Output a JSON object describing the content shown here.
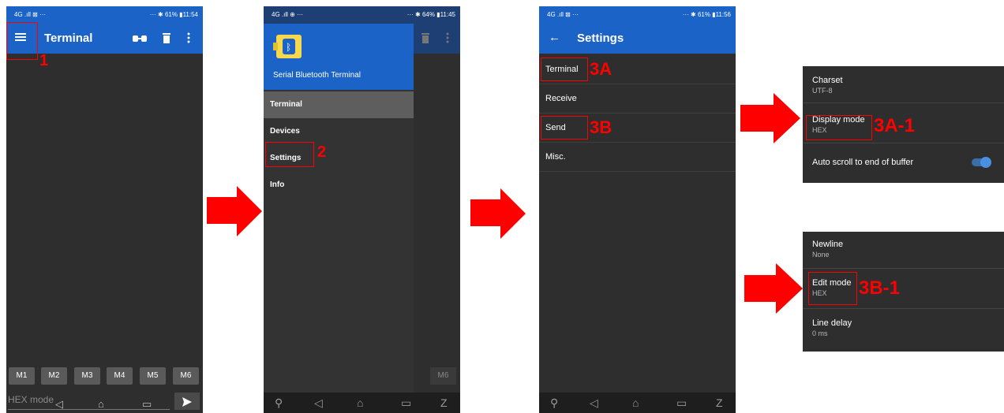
{
  "status1": {
    "left": "4G .ıll ⊠ ···",
    "right": "··· ✱ 61% ▮11:54"
  },
  "status2": {
    "left": "4G .ıll ⊕ ···",
    "right": "··· ✱ 64% ▮11:45"
  },
  "status3": {
    "left": "4G .ıll ⊠ ···",
    "right": "··· ✱ 61% ▮11:56"
  },
  "phone1": {
    "title": "Terminal",
    "macros": [
      "M1",
      "M2",
      "M3",
      "M4",
      "M5",
      "M6"
    ],
    "input_placeholder": "HEX mode"
  },
  "phone2": {
    "app_name": "Serial Bluetooth Terminal",
    "items": [
      "Terminal",
      "Devices",
      "Settings",
      "Info"
    ],
    "behind_macro": "M6"
  },
  "phone3": {
    "title": "Settings",
    "items": [
      "Terminal",
      "Receive",
      "Send",
      "Misc."
    ]
  },
  "panel_a": {
    "rows": [
      {
        "title": "Charset",
        "sub": "UTF-8"
      },
      {
        "title": "Display mode",
        "sub": "HEX"
      },
      {
        "title": "Auto scroll to end of buffer",
        "sub": ""
      }
    ]
  },
  "panel_b": {
    "rows": [
      {
        "title": "Newline",
        "sub": "None"
      },
      {
        "title": "Edit mode",
        "sub": "HEX"
      },
      {
        "title": "Line delay",
        "sub": "0 ms"
      }
    ]
  },
  "annotations": {
    "a1": "1",
    "a2": "2",
    "a3a": "3A",
    "a3b": "3B",
    "a3a1": "3A-1",
    "a3b1": "3B-1"
  },
  "colors": {
    "accent": "#1b63c6",
    "annotation": "#ff0000",
    "toggle": "#4a90e2"
  }
}
